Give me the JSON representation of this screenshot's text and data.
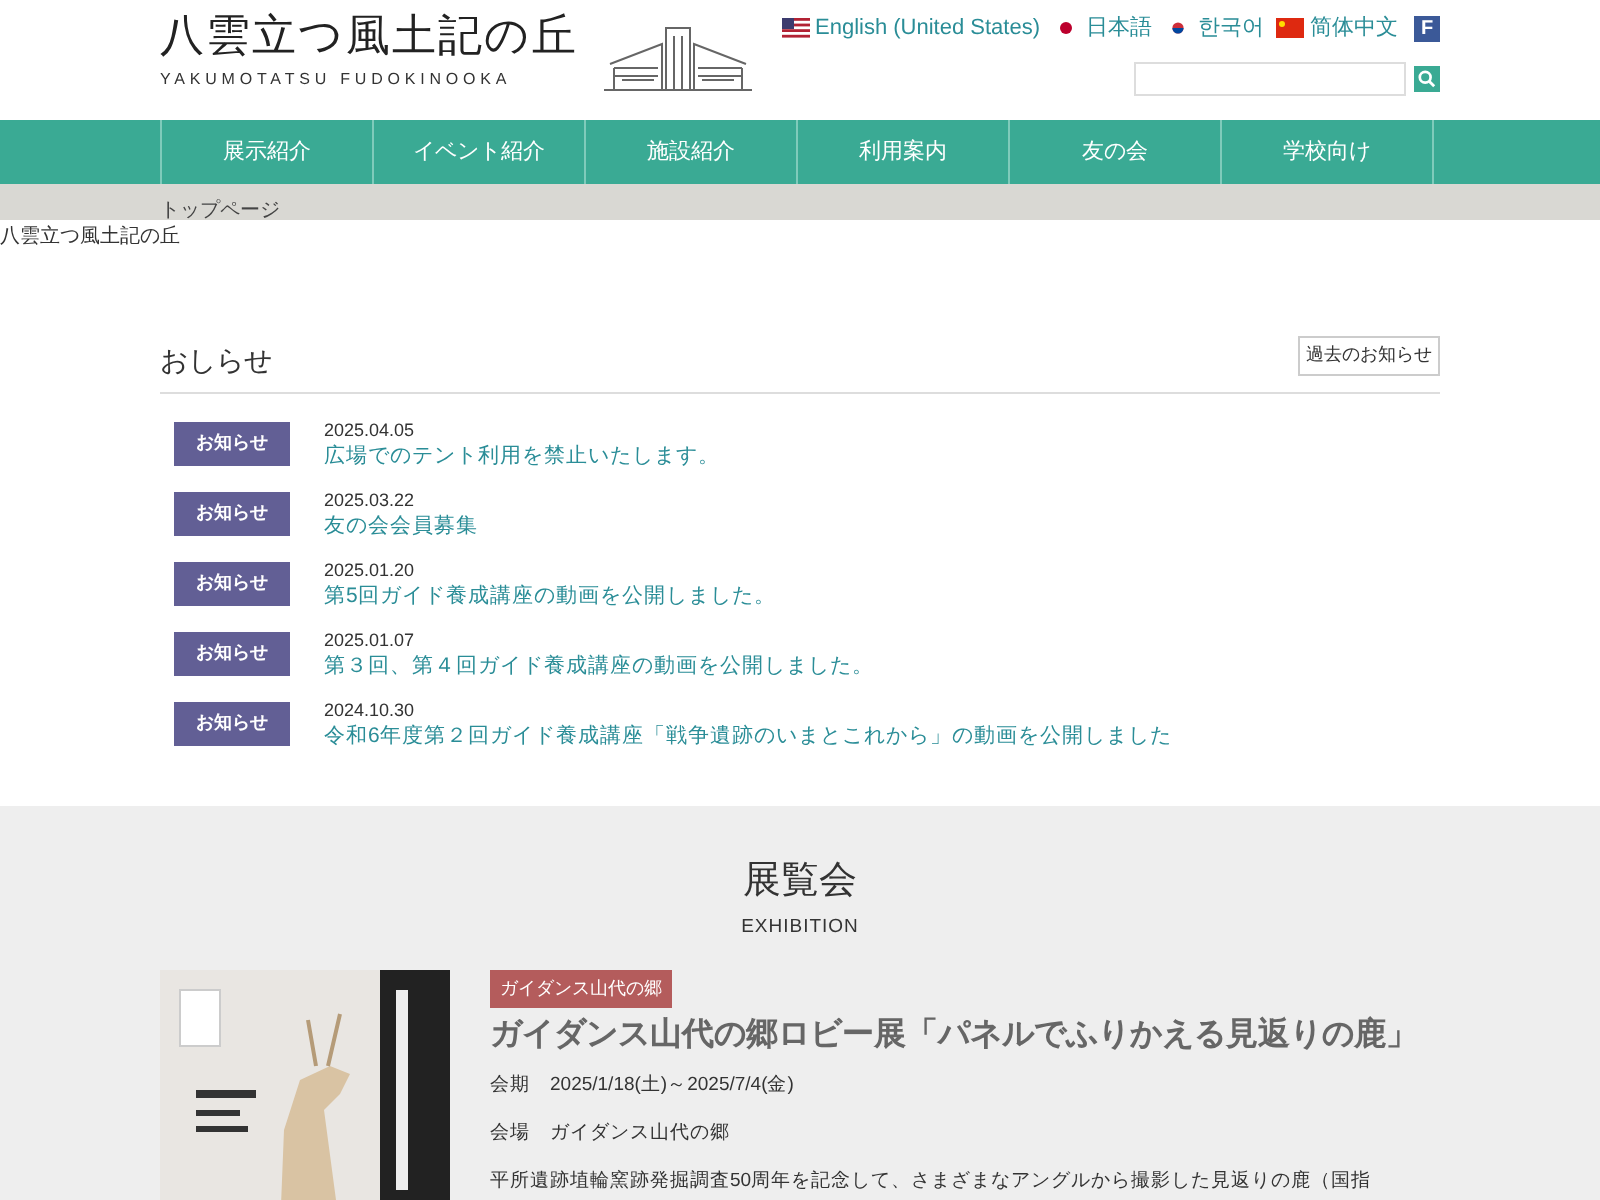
{
  "header": {
    "logo_title": "八雲立つ風土記の丘",
    "logo_subtitle": "YAKUMOTATSU FUDOKINOOKA",
    "languages": [
      {
        "label": "English (United States)",
        "kind": "us"
      },
      {
        "label": "日本語",
        "kind": "jp"
      },
      {
        "label": "한국어",
        "kind": "kr"
      },
      {
        "label": "简体中文",
        "kind": "cn"
      }
    ],
    "social": "F"
  },
  "nav": [
    "展示紹介",
    "イベント紹介",
    "施設紹介",
    "利用案内",
    "友の会",
    "学校向け"
  ],
  "breadcrumb": "トップページ",
  "banner_alt": "八雲立つ風土記の丘",
  "news": {
    "title": "おしらせ",
    "archive_button": "過去のお知らせ",
    "items": [
      {
        "tag": "お知らせ",
        "date": "2025.04.05",
        "title": "広場でのテント利用を禁止いたします。"
      },
      {
        "tag": "お知らせ",
        "date": "2025.03.22",
        "title": "友の会会員募集"
      },
      {
        "tag": "お知らせ",
        "date": "2025.01.20",
        "title": "第5回ガイド養成講座の動画を公開しました。"
      },
      {
        "tag": "お知らせ",
        "date": "2025.01.07",
        "title": "第３回、第４回ガイド養成講座の動画を公開しました。"
      },
      {
        "tag": "お知らせ",
        "date": "2024.10.30",
        "title": "令和6年度第２回ガイド養成講座「戦争遺跡のいまとこれから」の動画を公開しました"
      }
    ]
  },
  "exhibition": {
    "title": "展覧会",
    "subtitle": "EXHIBITION",
    "items": [
      {
        "kind": "picture",
        "tag": "ガイダンス山代の郷",
        "title": "ガイダンス山代の郷ロビー展「パネルでふりかえる見返りの鹿」",
        "period": "会期　2025/1/18(土)～2025/7/4(金)",
        "venue": "会場　ガイダンス山代の郷",
        "description": "平所遺跡埴輪窯跡発掘調査50周年を記念して、さまざまなアングルから撮影した見返りの鹿（国指"
      }
    ]
  }
}
